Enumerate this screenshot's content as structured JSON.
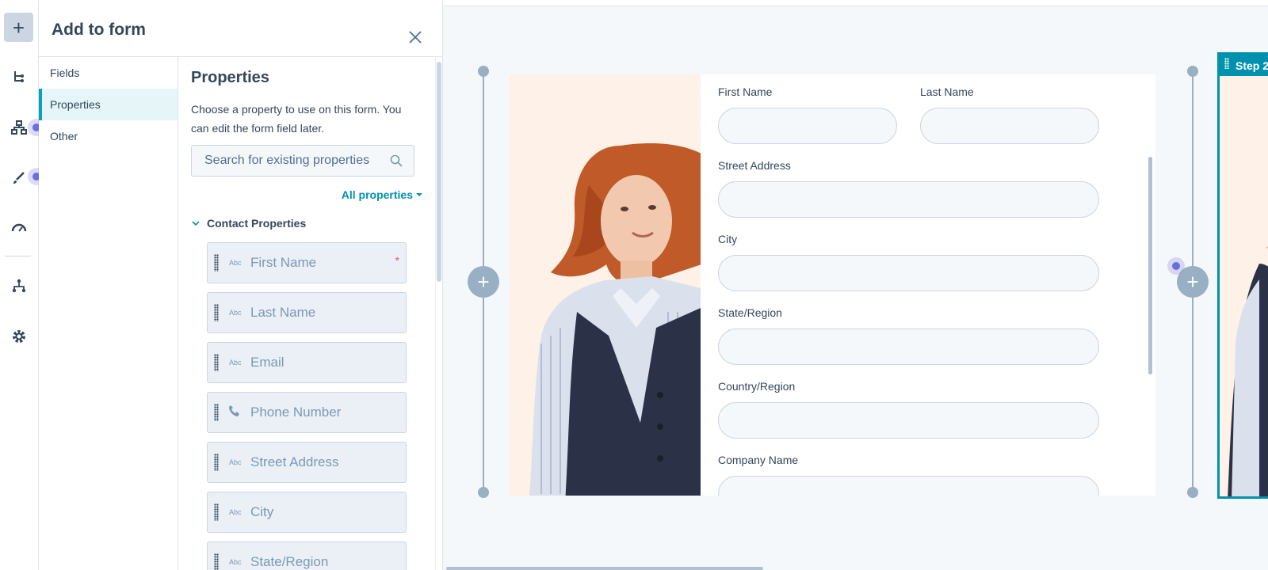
{
  "rail": {
    "items": [
      {
        "name": "add-icon",
        "symbol": "+"
      },
      {
        "name": "workflow-icon"
      },
      {
        "name": "hierarchy-icon"
      },
      {
        "name": "brush-icon"
      },
      {
        "name": "gauge-icon"
      },
      {
        "name": "sitemap-icon"
      },
      {
        "name": "gear-icon"
      }
    ]
  },
  "panel": {
    "title": "Add to form",
    "nav": [
      {
        "label": "Fields",
        "active": false
      },
      {
        "label": "Properties",
        "active": true
      },
      {
        "label": "Other",
        "active": false
      }
    ],
    "properties": {
      "title": "Properties",
      "description": "Choose a property to use on this form. You can edit the form field later.",
      "search_placeholder": "Search for existing properties",
      "filter_label": "All properties",
      "group_label": "Contact Properties",
      "items": [
        {
          "label": "First Name",
          "type": "Abc",
          "required": "*"
        },
        {
          "label": "Last Name",
          "type": "Abc",
          "required": ""
        },
        {
          "label": "Email",
          "type": "Abc",
          "required": ""
        },
        {
          "label": "Phone Number",
          "type": "phone",
          "required": ""
        },
        {
          "label": "Street Address",
          "type": "Abc",
          "required": ""
        },
        {
          "label": "City",
          "type": "Abc",
          "required": ""
        },
        {
          "label": "State/Region",
          "type": "Abc",
          "required": ""
        }
      ]
    }
  },
  "form": {
    "fields": {
      "first_name": "First Name",
      "last_name": "Last Name",
      "street": "Street Address",
      "city": "City",
      "state": "State/Region",
      "country": "Country/Region",
      "company": "Company Name"
    }
  },
  "step2": {
    "label": "Step 2"
  },
  "colors": {
    "accent": "#00a4bd",
    "text": "#33475b",
    "muted": "#7c98b6",
    "border": "#cbd6e2",
    "pulse": "#6a6fe0"
  }
}
